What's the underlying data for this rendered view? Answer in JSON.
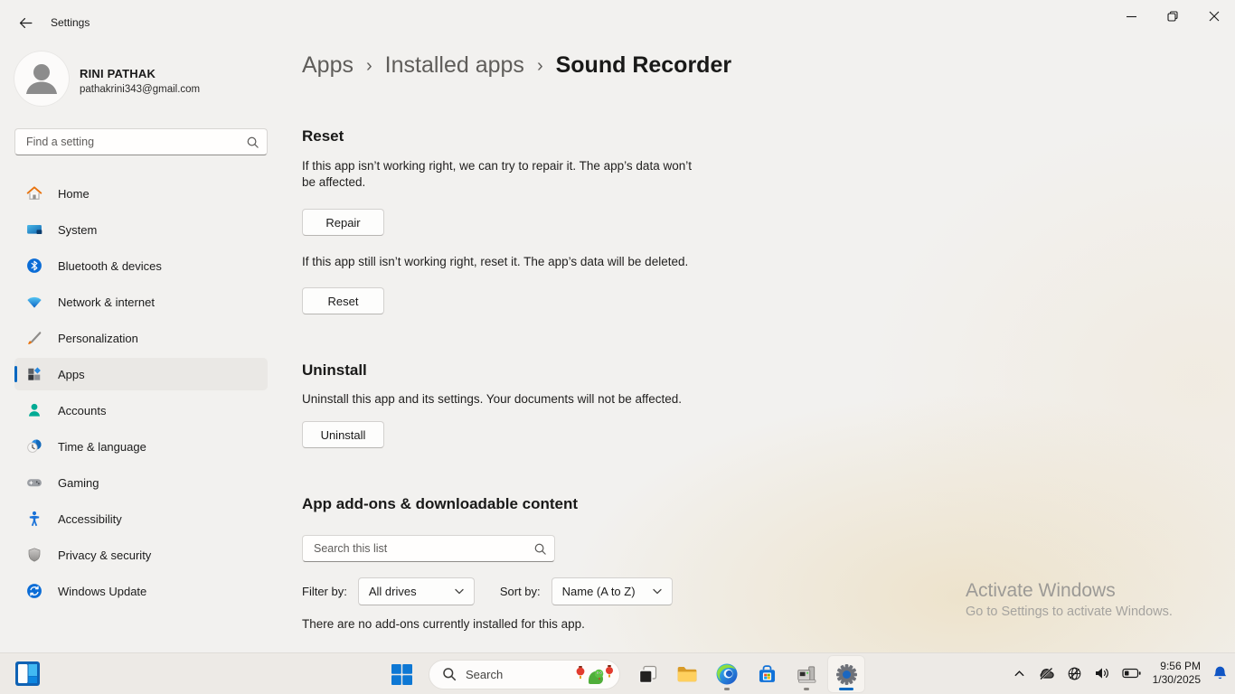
{
  "titlebar": {
    "title": "Settings"
  },
  "profile": {
    "name": "RINI PATHAK",
    "email": "pathakrini343@gmail.com"
  },
  "sidebar": {
    "search_placeholder": "Find a setting",
    "items": [
      {
        "label": "Home"
      },
      {
        "label": "System"
      },
      {
        "label": "Bluetooth & devices"
      },
      {
        "label": "Network & internet"
      },
      {
        "label": "Personalization"
      },
      {
        "label": "Apps",
        "selected": true
      },
      {
        "label": "Accounts"
      },
      {
        "label": "Time & language"
      },
      {
        "label": "Gaming"
      },
      {
        "label": "Accessibility"
      },
      {
        "label": "Privacy & security"
      },
      {
        "label": "Windows Update"
      }
    ]
  },
  "breadcrumb": {
    "root": "Apps",
    "parent": "Installed apps",
    "current": "Sound Recorder",
    "separator": "›"
  },
  "reset": {
    "heading": "Reset",
    "repair_description": "If this app isn’t working right, we can try to repair it. The app’s data won’t be affected.",
    "repair_button": "Repair",
    "reset_description": "If this app still isn’t working right, reset it. The app’s data will be deleted.",
    "reset_button": "Reset"
  },
  "uninstall": {
    "heading": "Uninstall",
    "description": "Uninstall this app and its settings. Your documents will not be affected.",
    "button": "Uninstall"
  },
  "addons": {
    "heading": "App add-ons & downloadable content",
    "search_placeholder": "Search this list",
    "filter_label": "Filter by:",
    "filter_value": "All drives",
    "sort_label": "Sort by:",
    "sort_value": "Name (A to Z)",
    "empty_message": "There are no add-ons currently installed for this app."
  },
  "watermark": {
    "title": "Activate Windows",
    "subtitle": "Go to Settings to activate Windows."
  },
  "taskbar": {
    "search_placeholder": "Search",
    "time": "9:56 PM",
    "date": "1/30/2025"
  },
  "colors": {
    "accent": "#0067c0",
    "selected_bg": "#eae8e5",
    "taskbar_bg": "#edeae6"
  }
}
